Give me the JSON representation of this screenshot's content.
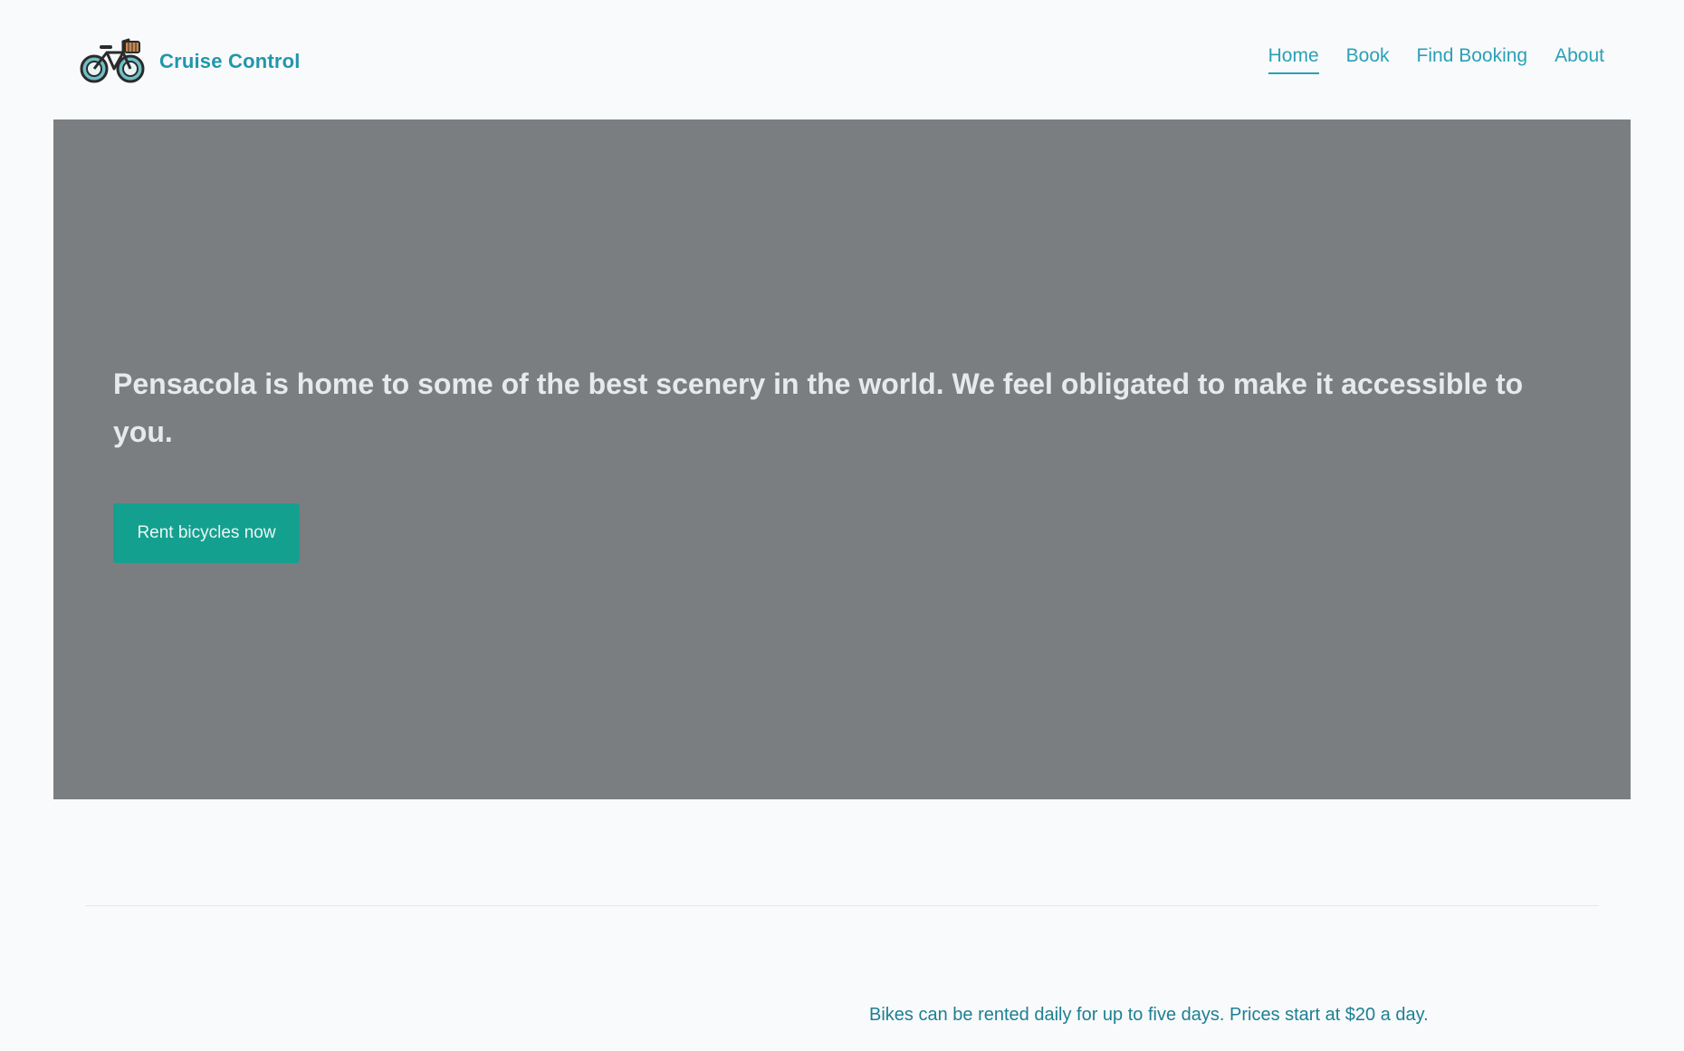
{
  "brand": {
    "name": "Cruise Control",
    "logo_icon": "bicycle-with-basket-icon"
  },
  "nav": {
    "items": [
      {
        "label": "Home",
        "active": true
      },
      {
        "label": "Book",
        "active": false
      },
      {
        "label": "Find Booking",
        "active": false
      },
      {
        "label": "About",
        "active": false
      }
    ]
  },
  "hero": {
    "headline": "Pensacola is home to some of the best scenery in the world. We feel obligated to make it accessible to you.",
    "cta_label": "Rent bicycles now"
  },
  "info": {
    "text": "Bikes can be rented daily for up to five days. Prices start at $20 a day."
  },
  "colors": {
    "accent": "#1f97ac",
    "nav_link": "#2aa0b7",
    "hero_background": "#7b7e81",
    "button": "#14a08f",
    "page_background": "#f9fafb"
  }
}
